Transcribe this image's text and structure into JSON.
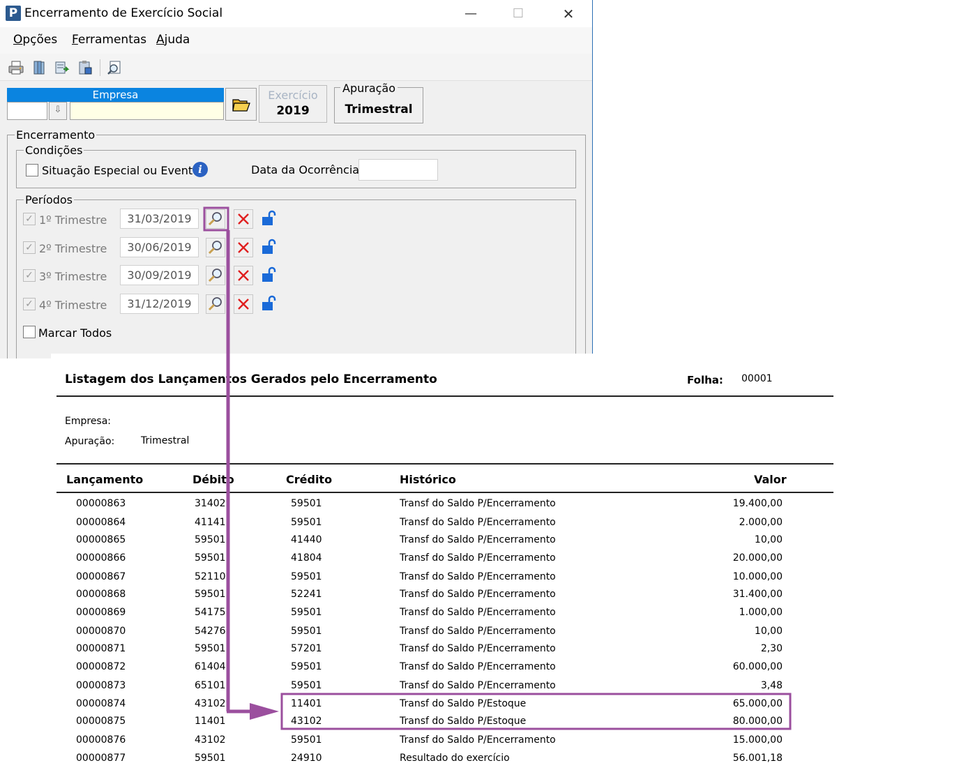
{
  "window": {
    "title": "Encerramento de Exercício Social",
    "controls": {
      "minimize": "—",
      "maximize": "☐",
      "close": "✕"
    }
  },
  "menu": {
    "items": [
      {
        "accel": "O",
        "rest": "pções"
      },
      {
        "accel": "F",
        "rest": "erramentas"
      },
      {
        "accel": "A",
        "rest": "juda"
      }
    ]
  },
  "toolbar": {
    "icons": [
      "printer-icon",
      "books-icon",
      "export-icon",
      "clipboard-icon",
      "magnifier-icon"
    ]
  },
  "empresa": {
    "label": "Empresa",
    "code_value": "",
    "name_value": ""
  },
  "exercicio": {
    "label": "Exercício",
    "value": "2019"
  },
  "apuracao": {
    "label": "Apuração",
    "value": "Trimestral"
  },
  "encerramento": {
    "legend": "Encerramento",
    "condicoes": {
      "legend": "Condições",
      "situacao_label": "Situação Especial ou Evento",
      "situacao_checked": false,
      "data_label": "Data da Ocorrência:",
      "data_value": ""
    },
    "periodos": {
      "legend": "Períodos",
      "items": [
        {
          "label": "1º Trimestre",
          "date": "31/03/2019",
          "checked": true
        },
        {
          "label": "2º Trimestre",
          "date": "30/06/2019",
          "checked": true
        },
        {
          "label": "3º Trimestre",
          "date": "30/09/2019",
          "checked": true
        },
        {
          "label": "4º Trimestre",
          "date": "31/12/2019",
          "checked": true
        }
      ],
      "marcar_todos": "Marcar Todos"
    }
  },
  "report": {
    "title": "Listagem dos Lançamentos Gerados pelo Encerramento",
    "folha_label": "Folha:",
    "folha_value": "00001",
    "empresa_label": "Empresa:",
    "empresa_value": "",
    "apuracao_label": "Apuração:",
    "apuracao_value": "Trimestral",
    "columns": {
      "lancamento": "Lançamento",
      "debito": "Débito",
      "credito": "Crédito",
      "historico": "Histórico",
      "valor": "Valor"
    },
    "rows": [
      {
        "lancamento": "00000863",
        "debito": "31402",
        "credito": "59501",
        "historico": "Transf do Saldo P/Encerramento",
        "valor": "19.400,00"
      },
      {
        "lancamento": "00000864",
        "debito": "41141",
        "credito": "59501",
        "historico": "Transf do Saldo P/Encerramento",
        "valor": "2.000,00"
      },
      {
        "lancamento": "00000865",
        "debito": "59501",
        "credito": "41440",
        "historico": "Transf do Saldo P/Encerramento",
        "valor": "10,00"
      },
      {
        "lancamento": "00000866",
        "debito": "59501",
        "credito": "41804",
        "historico": "Transf do Saldo P/Encerramento",
        "valor": "20.000,00"
      },
      {
        "lancamento": "00000867",
        "debito": "52110",
        "credito": "59501",
        "historico": "Transf do Saldo P/Encerramento",
        "valor": "10.000,00"
      },
      {
        "lancamento": "00000868",
        "debito": "59501",
        "credito": "52241",
        "historico": "Transf do Saldo P/Encerramento",
        "valor": "31.400,00"
      },
      {
        "lancamento": "00000869",
        "debito": "54175",
        "credito": "59501",
        "historico": "Transf do Saldo P/Encerramento",
        "valor": "1.000,00"
      },
      {
        "lancamento": "00000870",
        "debito": "54276",
        "credito": "59501",
        "historico": "Transf do Saldo P/Encerramento",
        "valor": "10,00"
      },
      {
        "lancamento": "00000871",
        "debito": "59501",
        "credito": "57201",
        "historico": "Transf do Saldo P/Encerramento",
        "valor": "2,30"
      },
      {
        "lancamento": "00000872",
        "debito": "61404",
        "credito": "59501",
        "historico": "Transf do Saldo P/Encerramento",
        "valor": "60.000,00"
      },
      {
        "lancamento": "00000873",
        "debito": "65101",
        "credito": "59501",
        "historico": "Transf do Saldo P/Encerramento",
        "valor": "3,48"
      },
      {
        "lancamento": "00000874",
        "debito": "43102",
        "credito": "11401",
        "historico": "Transf do Saldo P/Estoque",
        "valor": "65.000,00"
      },
      {
        "lancamento": "00000875",
        "debito": "11401",
        "credito": "43102",
        "historico": "Transf do Saldo P/Estoque",
        "valor": "80.000,00"
      },
      {
        "lancamento": "00000876",
        "debito": "43102",
        "credito": "59501",
        "historico": "Transf do Saldo P/Encerramento",
        "valor": "15.000,00"
      },
      {
        "lancamento": "00000877",
        "debito": "59501",
        "credito": "24910",
        "historico": "Resultado do exercício",
        "valor": "56.001,18"
      }
    ]
  },
  "annotation": {
    "color": "#9b4f9e"
  }
}
